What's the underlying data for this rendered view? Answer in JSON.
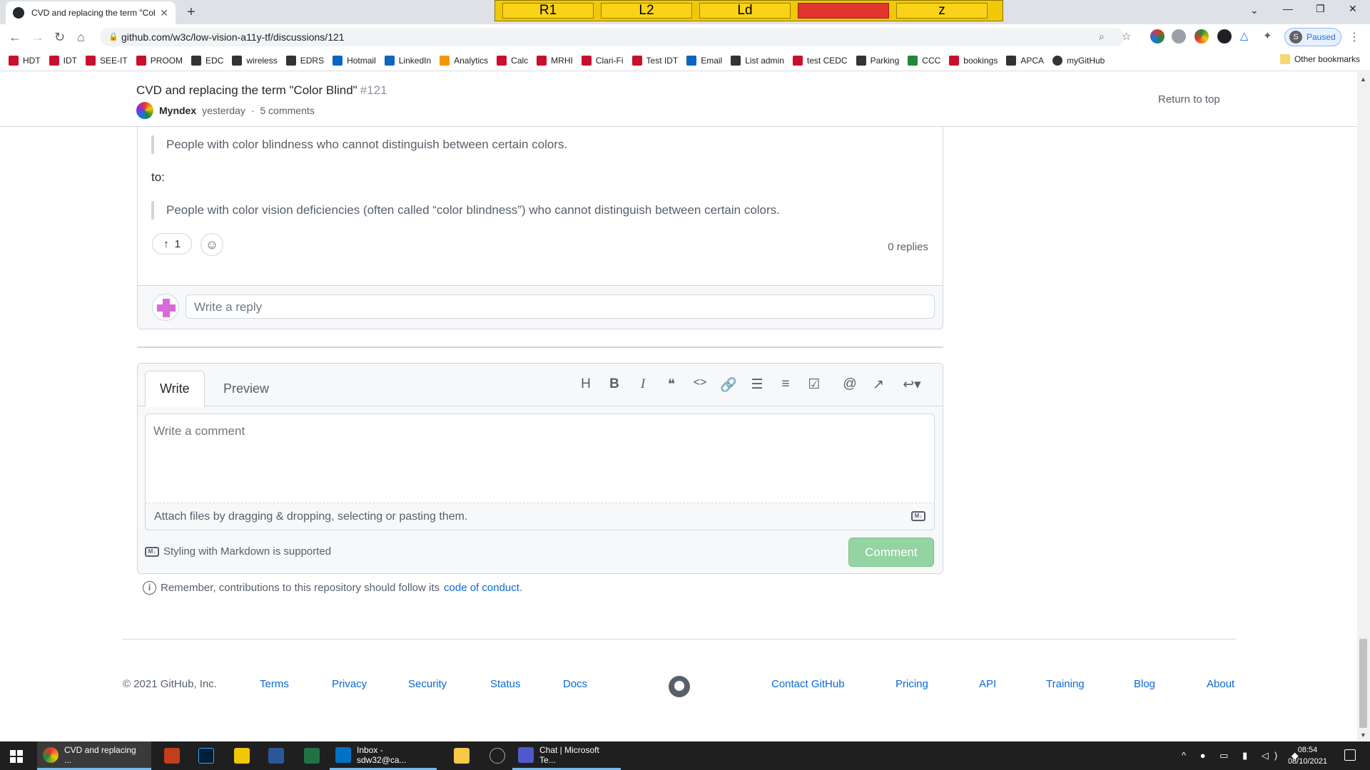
{
  "browser": {
    "tab_title": "CVD and replacing the term \"Col",
    "url": "github.com/w3c/low-vision-a11y-tf/discussions/121",
    "profile_status": "Paused",
    "profile_initial": "S",
    "bookmarks": [
      "HDT",
      "IDT",
      "SEE-IT",
      "PROOM",
      "EDC",
      "wireless",
      "EDRS",
      "Hotmail",
      "LinkedIn",
      "Analytics",
      "Calc",
      "MRHI",
      "Clari-Fi",
      "Test IDT",
      "Email",
      "List admin",
      "test CEDC",
      "Parking",
      "CCC",
      "bookings",
      "APCA",
      "myGitHub"
    ],
    "other_bookmarks": "Other bookmarks"
  },
  "overlay": {
    "boxes": [
      "R1",
      "L2",
      "Ld",
      "",
      "z"
    ]
  },
  "discussion": {
    "title": "CVD and replacing the term \"Color Blind\"",
    "number": "#121",
    "author": "Myndex",
    "time": "yesterday",
    "separator": "·",
    "comments": "5 comments",
    "return_top": "Return to top"
  },
  "comment": {
    "quote1": "People with color blindness who cannot distinguish between certain colors.",
    "to": "to:",
    "quote2": "People with color vision deficiencies (often called “color blindness”) who cannot distinguish between certain colors.",
    "upvotes": "1",
    "replies": "0 replies",
    "reply_placeholder": "Write a reply"
  },
  "editor": {
    "tab_write": "Write",
    "tab_preview": "Preview",
    "placeholder": "Write a comment",
    "attach": "Attach files by dragging & dropping, selecting or pasting them.",
    "markdown_note": "Styling with Markdown is supported",
    "comment_button": "Comment"
  },
  "conduct": {
    "text": "Remember, contributions to this repository should follow its",
    "link": "code of conduct",
    "period": "."
  },
  "footer": {
    "copyright": "© 2021 GitHub, Inc.",
    "left_links": [
      "Terms",
      "Privacy",
      "Security",
      "Status",
      "Docs"
    ],
    "right_links": [
      "Contact GitHub",
      "Pricing",
      "API",
      "Training",
      "Blog",
      "About"
    ]
  },
  "taskbar": {
    "chrome": "CVD and replacing ...",
    "outlook": "Inbox - sdw32@ca...",
    "teams": "Chat | Microsoft Te...",
    "time": "08:54",
    "date": "08/10/2021"
  },
  "colors": {
    "accent": "#0969da",
    "comment_button": "#94d3a2",
    "overlay": "#f0c808"
  }
}
